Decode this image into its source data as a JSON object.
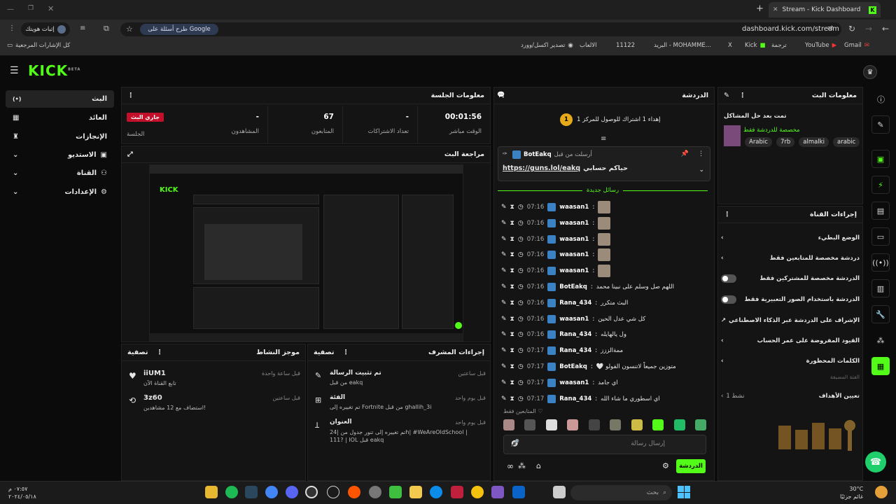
{
  "browser": {
    "tab_title": "Stream - Kick Dashboard",
    "url": "dashboard.kick.com/stream",
    "verify_identity": "إثبات هويتك",
    "ask_google": "طرح أسئلة على Google",
    "bookmarks": [
      "Gmail",
      "YouTube",
      "ترجمة",
      "Kick",
      "X",
      "البريد - MOHAMME...",
      "11122",
      "الالعاب",
      "تصدير اكسل/وورد",
      "كل الإشارات المرجعية"
    ]
  },
  "app": {
    "logo": "KICK",
    "beta": "BETA",
    "sidebar": [
      {
        "label": "البث",
        "icon": "(•)"
      },
      {
        "label": "العائد",
        "icon": "▦"
      },
      {
        "label": "الإنجازات",
        "icon": "🏆"
      },
      {
        "label": "الاستديو",
        "icon": "▣"
      },
      {
        "label": "القناة",
        "icon": "⚙"
      },
      {
        "label": "الإعدادات",
        "icon": "⚙"
      }
    ]
  },
  "session": {
    "title": "معلومات الجلسة",
    "stats": [
      {
        "value": "00:01:56",
        "label": "الوقت مباشر"
      },
      {
        "value": "-",
        "label": "تعداد الاشتراكات"
      },
      {
        "value": "67",
        "label": "المتابعون"
      },
      {
        "value": "-",
        "label": "المشاهدون"
      }
    ],
    "live_badge": "جاري البث",
    "session_label": "الجلسة"
  },
  "preview": {
    "title": "مراجعة البث"
  },
  "activity": {
    "title": "موجز النشاط",
    "filter": "تصفية",
    "items": [
      {
        "name": "iiUM1",
        "desc": "تابع القناة الآن",
        "time": "قبل ساعة واحدة"
      },
      {
        "name": "3z60",
        "desc": "استضاف مع 12 مشاهدين!",
        "time": "قبل ساعتين"
      }
    ]
  },
  "mod": {
    "title": "إجراءات المشرف",
    "filter": "تصفية",
    "items": [
      {
        "title": "تم تثبيت الرسالة",
        "by": "من قبل eakq",
        "time": "قبل ساعتين"
      },
      {
        "title": "الفئة",
        "by": "تم تغييره إلى Fortnite من قبل ghallih_3i",
        "time": "قبل يوم واحد"
      },
      {
        "title": "العنوان",
        "by": "تم تغييره إلى تنور جدول من |24h| #WeAreOldSchool | 111? | IOL قبل eakq",
        "time": "قبل يوم واحد"
      }
    ]
  },
  "chat": {
    "title": "الدردشة",
    "goal": "إهداء 1 اشتراك للوصول للمركز 1",
    "goal_rank": "1",
    "pinned_by": "BotEakq",
    "pinned_label": "أرسلت من قبل",
    "pinned_link": "https://guns.lol/eakq",
    "pinned_text": "حياكم حسابي",
    "new_messages": "رسائل جديدة",
    "followers_only": "المتابعين فقط",
    "input_placeholder": "إرسال رسالة",
    "send": "الدردشة",
    "messages": [
      {
        "time": "07:16",
        "user": "waasan1",
        "text": ""
      },
      {
        "time": "07:16",
        "user": "waasan1",
        "text": ""
      },
      {
        "time": "07:16",
        "user": "waasan1",
        "text": ""
      },
      {
        "time": "07:16",
        "user": "waasan1",
        "text": ""
      },
      {
        "time": "07:16",
        "user": "waasan1",
        "text": ""
      },
      {
        "time": "07:16",
        "user": "BotEakq",
        "text": "اللهم صل وسلم على نبينا محمد"
      },
      {
        "time": "07:16",
        "user": "Rana_434",
        "text": "البث متكرر"
      },
      {
        "time": "07:16",
        "user": "waasan1",
        "text": "كل شي عدل الحين"
      },
      {
        "time": "07:16",
        "user": "Rana_434",
        "text": "ول يالهايله"
      },
      {
        "time": "07:17",
        "user": "Rana_434",
        "text": "ممةالززز"
      },
      {
        "time": "07:17",
        "user": "BotEakq",
        "text": "متوزين جميعاً لاتنسون الفولو 🤍"
      },
      {
        "time": "07:17",
        "user": "waasan1",
        "text": "اي جامد"
      },
      {
        "time": "07:17",
        "user": "Rana_434",
        "text": "اي اسطوري ما شاء الله"
      }
    ]
  },
  "stream_info": {
    "title": "معلومات البث",
    "headline": "تمت بعد حل المشاكل",
    "sub": "مخصصة للدردشة فقط",
    "tags": [
      "Arabic",
      "7rb",
      "almalki",
      "arabic"
    ]
  },
  "channel_actions": {
    "title": "إجراءات القناة",
    "items": [
      {
        "label": "الوضع البطيء",
        "ctrl": "chevron"
      },
      {
        "label": "دردشة مخصصة للمتابعين فقط",
        "ctrl": "chevron"
      },
      {
        "label": "الدردشة مخصصة للمشتركين فقط",
        "ctrl": "toggle"
      },
      {
        "label": "الدردشة باستخدام الصور التعبيرية فقط",
        "ctrl": "toggle"
      },
      {
        "label": "الإشراف على الدردشة عبر الذكاء الاصطناعي",
        "ctrl": "link"
      },
      {
        "label": "القيود المفروضة على عمر الحساب",
        "ctrl": "chevron"
      },
      {
        "label": "الكلمات المحظورة",
        "ctrl": "chevron"
      }
    ],
    "category_hint": "الفئة المضيفة",
    "goals": "تعيين الأهداف",
    "goals_value": "نشط 1"
  },
  "taskbar": {
    "search": "بحث",
    "weather_temp": "30°C",
    "weather_desc": "غائم جزئيًا",
    "time": "٠٧:٥٧ م",
    "date": "٢٠٢٤/٠٥/١٨"
  }
}
